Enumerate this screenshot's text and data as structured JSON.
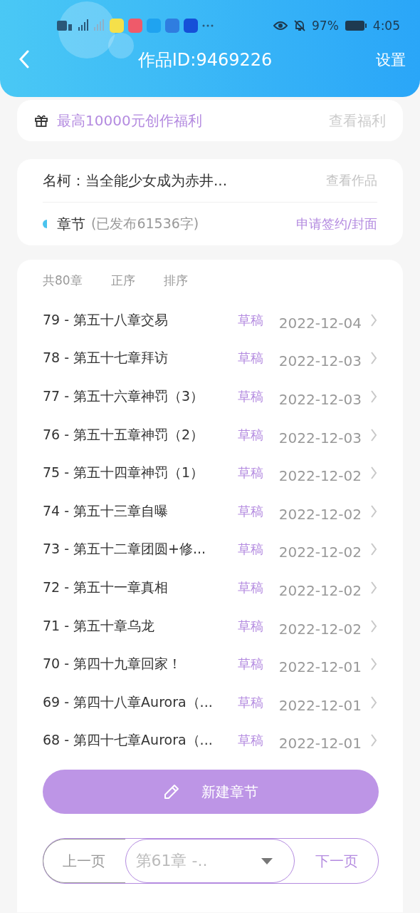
{
  "status_bar": {
    "battery": "97%",
    "time": "4:05"
  },
  "header": {
    "title": "作品ID:9469226",
    "action": "设置"
  },
  "promo": {
    "text": "最高10000元创作福利",
    "link": "查看福利"
  },
  "work": {
    "title": "名柯：当全能少女成为赤井...",
    "link": "查看作品",
    "section": "章节",
    "word_count": "(已发布61536字)",
    "apply": "申请签约/封面"
  },
  "list_header": [
    "共80章",
    "正序",
    "排序"
  ],
  "chapters": [
    {
      "title": "79 - 第五十八章交易",
      "status": "草稿",
      "date": "2022-12-04"
    },
    {
      "title": "78 - 第五十七章拜访",
      "status": "草稿",
      "date": "2022-12-03"
    },
    {
      "title": "77 - 第五十六章神罚（3）",
      "status": "草稿",
      "date": "2022-12-03"
    },
    {
      "title": "76 - 第五十五章神罚（2）",
      "status": "草稿",
      "date": "2022-12-03"
    },
    {
      "title": "75 - 第五十四章神罚（1）",
      "status": "草稿",
      "date": "2022-12-02"
    },
    {
      "title": "74 - 第五十三章自曝",
      "status": "草稿",
      "date": "2022-12-02"
    },
    {
      "title": "73 - 第五十二章团圆+修...",
      "status": "草稿",
      "date": "2022-12-02"
    },
    {
      "title": "72 - 第五十一章真相",
      "status": "草稿",
      "date": "2022-12-02"
    },
    {
      "title": "71 - 第五十章乌龙",
      "status": "草稿",
      "date": "2022-12-02"
    },
    {
      "title": "70 - 第四十九章回家！",
      "status": "草稿",
      "date": "2022-12-01"
    },
    {
      "title": "69 - 第四十八章Aurora（...",
      "status": "草稿",
      "date": "2022-12-01"
    },
    {
      "title": "68 - 第四十七章Aurora（...",
      "status": "草稿",
      "date": "2022-12-01"
    }
  ],
  "new_button": "新建章节",
  "pager": {
    "prev": {
      "label": "上一页",
      "disabled": true
    },
    "select": {
      "value": "第61章 -.."
    },
    "next": {
      "label": "下一页",
      "disabled": false
    }
  }
}
